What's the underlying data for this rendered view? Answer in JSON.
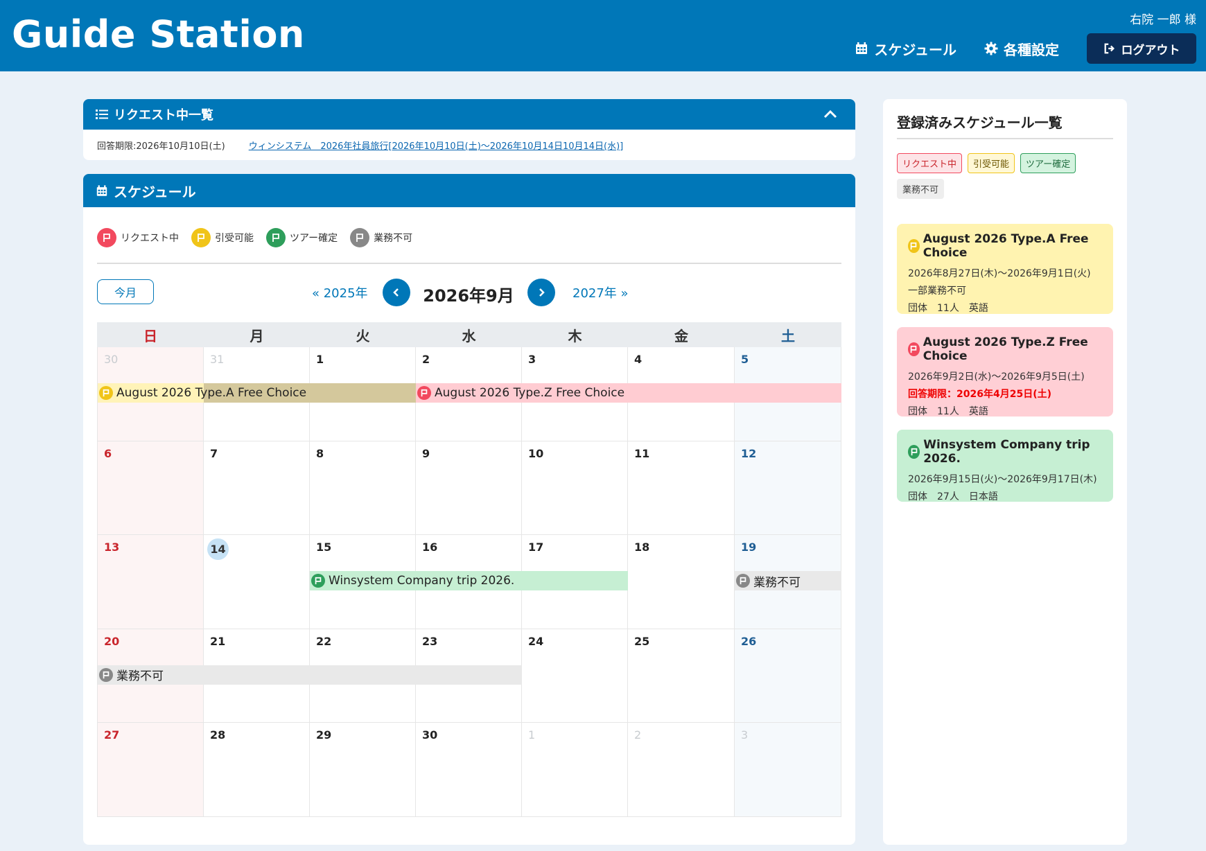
{
  "header": {
    "logo": "Guide Station",
    "user": "右院 一郎 様",
    "nav_schedule": "スケジュール",
    "nav_settings": "各種設定",
    "nav_logout": "ログアウト"
  },
  "requests": {
    "title": "リクエスト中一覧",
    "deadline": "回答期限:2026年10月10日(土)",
    "link": "ウィンシステム　2026年社員旅行[2026年10月10日(土)〜2026年10月14日10月14日(水)]"
  },
  "schedule": {
    "title": "スケジュール",
    "legend": [
      "リクエスト中",
      "引受可能",
      "ツアー確定",
      "業務不可"
    ],
    "today_label": "今月",
    "prev_year": "« 2025年",
    "next_year": "2027年 »",
    "month_title": "2026年9月",
    "weekdays": [
      "日",
      "月",
      "火",
      "水",
      "木",
      "金",
      "土"
    ],
    "weeks": [
      [
        "30",
        "31",
        "1",
        "2",
        "3",
        "4",
        "5"
      ],
      [
        "6",
        "7",
        "8",
        "9",
        "10",
        "11",
        "12"
      ],
      [
        "13",
        "14",
        "15",
        "16",
        "17",
        "18",
        "19"
      ],
      [
        "20",
        "21",
        "22",
        "23",
        "24",
        "25",
        "26"
      ],
      [
        "27",
        "28",
        "29",
        "30",
        "1",
        "2",
        "3"
      ]
    ],
    "events": {
      "a": "August 2026 Type.A Free Choice",
      "z": "August 2026 Type.Z Free Choice",
      "w": "Winsystem Company trip 2026.",
      "u1": "業務不可",
      "u2": "業務不可"
    }
  },
  "side": {
    "title": "登録済みスケジュール一覧",
    "badges": [
      "リクエスト中",
      "引受可能",
      "ツアー確定",
      "業務不可"
    ],
    "cards": [
      {
        "title": "August 2026 Type.A Free Choice",
        "dates": "2026年8月27日(木)〜2026年9月1日(火)",
        "note": "一部業務不可",
        "info": "団体　11人　英語"
      },
      {
        "title": "August 2026 Type.Z Free Choice",
        "dates": "2026年9月2日(水)〜2026年9月5日(土)",
        "note": "回答期限：2026年4月25日(土)",
        "info": "団体　11人　英語"
      },
      {
        "title": "Winsystem Company trip 2026.",
        "dates": "2026年9月15日(火)〜2026年9月17日(木)",
        "info": "団体　27人　日本語"
      }
    ]
  },
  "colors": {
    "brand": "#0077b8",
    "request": "#f2495e",
    "acceptable": "#f0c419",
    "confirmed": "#2e9e5b",
    "unavailable": "#888888"
  }
}
